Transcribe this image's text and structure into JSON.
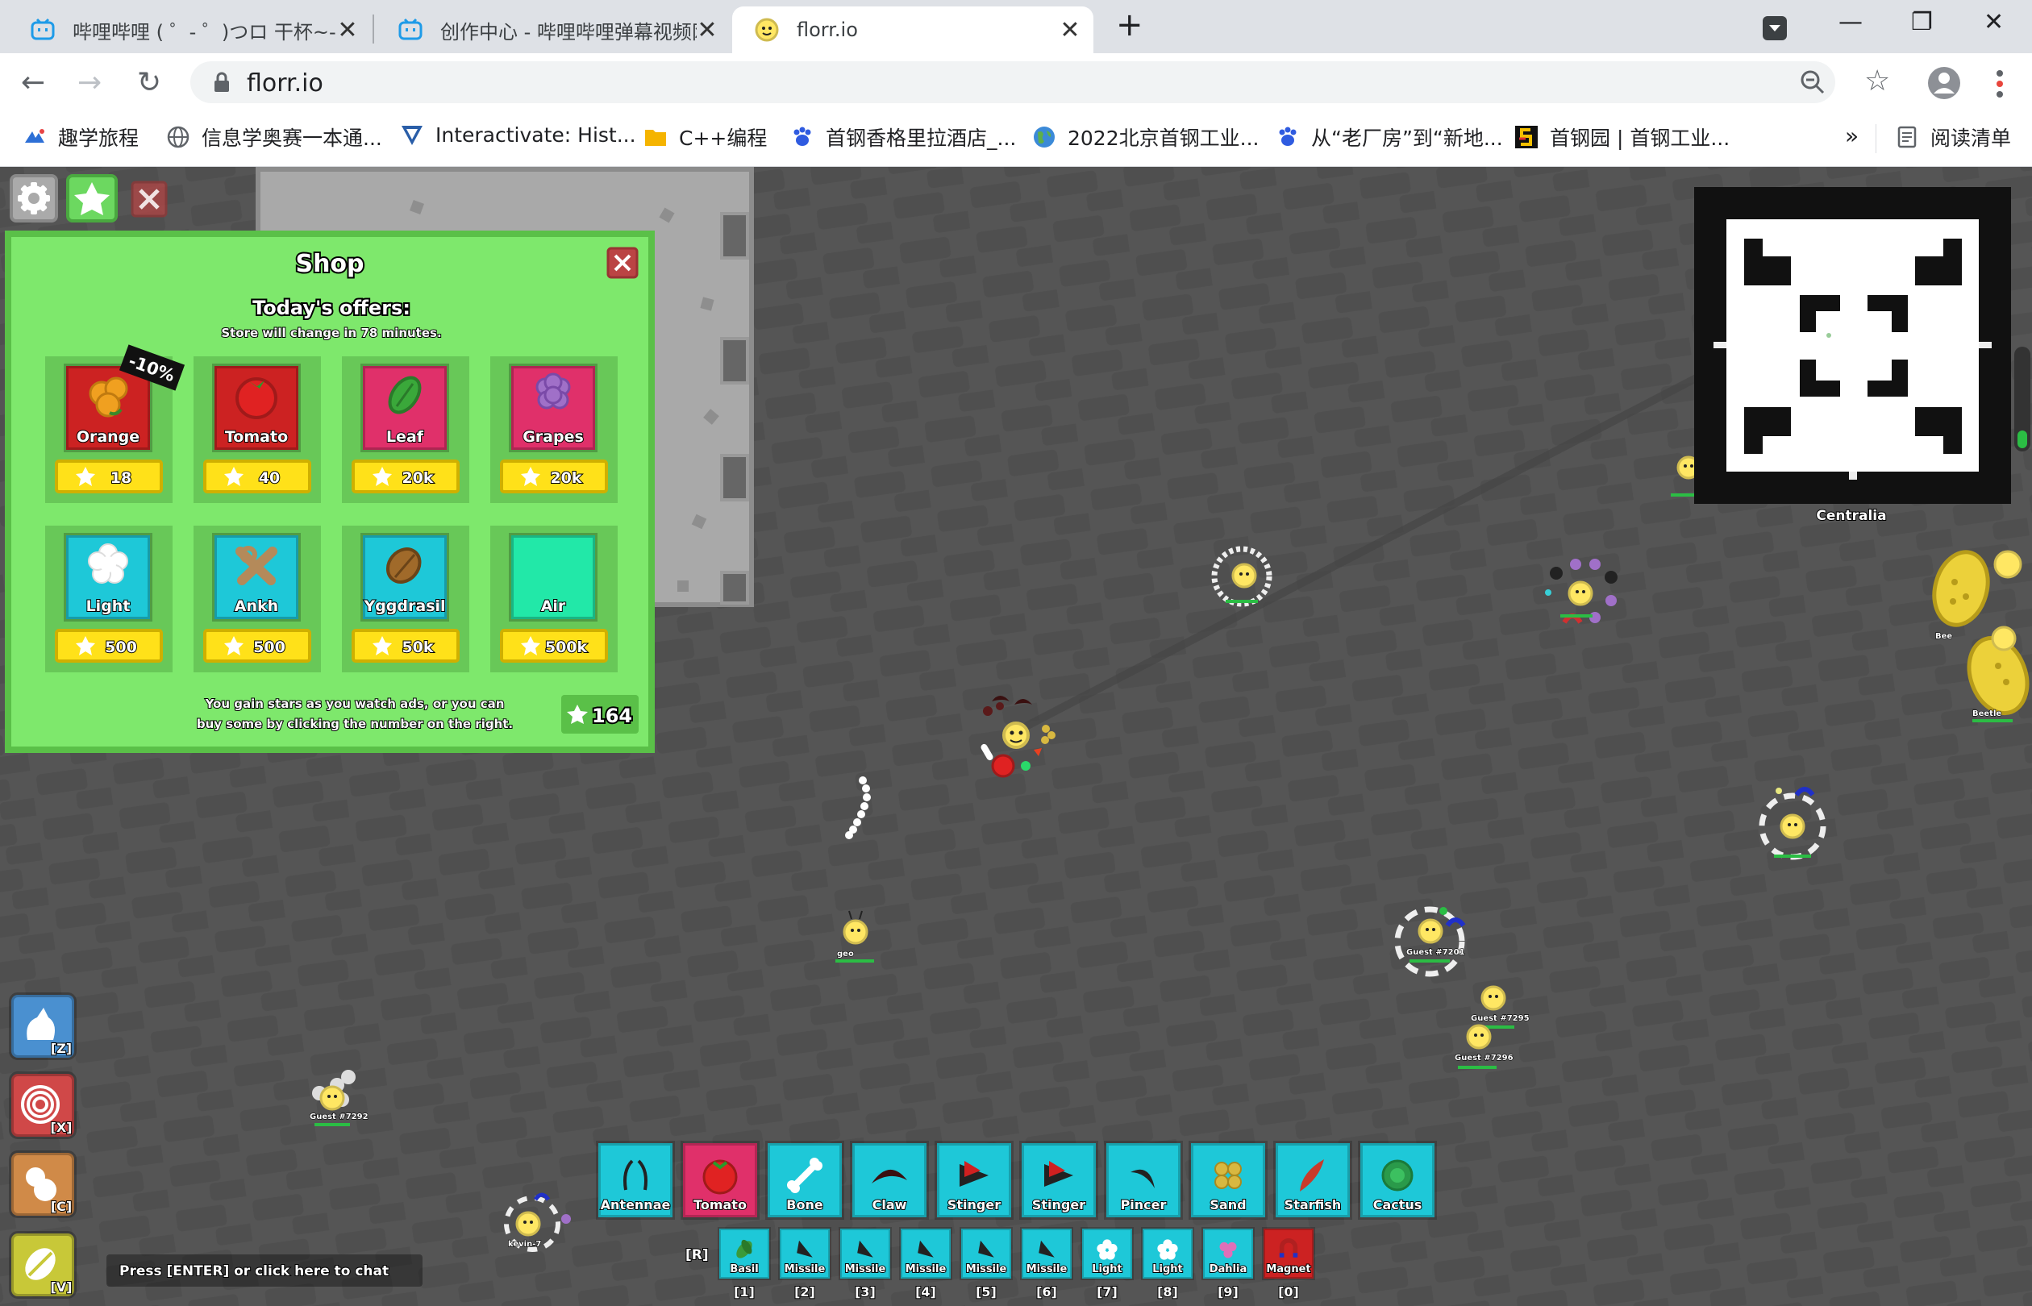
{
  "browser": {
    "tabs": [
      {
        "title": "哔哩哔哩 ( ゜- ゜)つロ 干杯~-b",
        "active": false,
        "icon": "bilibili-icon"
      },
      {
        "title": "创作中心 - 哔哩哔哩弹幕视频网",
        "active": false,
        "icon": "bilibili-icon"
      },
      {
        "title": "florr.io",
        "active": true,
        "icon": "florr-icon"
      }
    ],
    "new_tab": "+",
    "url": "florr.io",
    "bookmarks": [
      "趣学旅程",
      "信息学奥赛一本通...",
      "Interactivate: Hist...",
      "C++编程",
      "首钢香格里拉酒店_...",
      "2022北京首钢工业...",
      "从“老厂房”到“新地...",
      "首钢园 | 首钢工业..."
    ],
    "more_bookmarks": "»",
    "reading_list": "阅读清单",
    "colors": {
      "tabstrip": "#dee1e6",
      "toolbar": "#ffffff"
    }
  },
  "shop": {
    "title": "Shop",
    "subtitle": "Today's offers:",
    "refresh_note": "Store will change in 78 minutes.",
    "items": [
      {
        "name": "Orange",
        "price": "18",
        "rarity_color": "#cc2222",
        "discount": "-10%"
      },
      {
        "name": "Tomato",
        "price": "40",
        "rarity_color": "#cc2222",
        "discount": ""
      },
      {
        "name": "Leaf",
        "price": "20k",
        "rarity_color": "#e0306a",
        "discount": ""
      },
      {
        "name": "Grapes",
        "price": "20k",
        "rarity_color": "#e0306a",
        "discount": ""
      },
      {
        "name": "Light",
        "price": "500",
        "rarity_color": "#1ec8d8",
        "discount": ""
      },
      {
        "name": "Ankh",
        "price": "500",
        "rarity_color": "#1ec8d8",
        "discount": ""
      },
      {
        "name": "Yggdrasil",
        "price": "50k",
        "rarity_color": "#1ec8d8",
        "discount": ""
      },
      {
        "name": "Air",
        "price": "500k",
        "rarity_color": "#22e8a8",
        "discount": ""
      }
    ],
    "footer": [
      "You gain stars as you watch ads, or you can",
      "buy some by clicking the number on the right."
    ],
    "star_count": "164",
    "colors": {
      "panel": "#7ee86c",
      "border": "#5ac048",
      "price_bar": "#ffe119"
    }
  },
  "minimap": {
    "label": "Centralia"
  },
  "abilities": [
    {
      "key": "[Z]",
      "icon": "bag-icon",
      "color": "#4a90d0"
    },
    {
      "key": "[X]",
      "icon": "swirl-icon",
      "color": "#d04848"
    },
    {
      "key": "[C]",
      "icon": "flower-icon",
      "color": "#d08a48"
    },
    {
      "key": "[V]",
      "icon": "bee-icon",
      "color": "#c8c838"
    }
  ],
  "chat_prompt": "Press [ENTER] or click here to chat",
  "loadout": {
    "primary": [
      {
        "name": "Antennae",
        "color": "#1ec8d8"
      },
      {
        "name": "Tomato",
        "color": "#e0306a"
      },
      {
        "name": "Bone",
        "color": "#1ec8d8"
      },
      {
        "name": "Claw",
        "color": "#1ec8d8"
      },
      {
        "name": "Stinger",
        "color": "#1ec8d8"
      },
      {
        "name": "Stinger",
        "color": "#1ec8d8"
      },
      {
        "name": "Pincer",
        "color": "#1ec8d8"
      },
      {
        "name": "Sand",
        "color": "#1ec8d8"
      },
      {
        "name": "Starfish",
        "color": "#1ec8d8"
      },
      {
        "name": "Cactus",
        "color": "#1ec8d8"
      }
    ],
    "swap_key": "[R]",
    "secondary": [
      {
        "name": "Basil",
        "key": "[1]",
        "color": "#1ec8d8"
      },
      {
        "name": "Missile",
        "key": "[2]",
        "color": "#1ec8d8"
      },
      {
        "name": "Missile",
        "key": "[3]",
        "color": "#1ec8d8"
      },
      {
        "name": "Missile",
        "key": "[4]",
        "color": "#1ec8d8"
      },
      {
        "name": "Missile",
        "key": "[5]",
        "color": "#1ec8d8"
      },
      {
        "name": "Missile",
        "key": "[6]",
        "color": "#1ec8d8"
      },
      {
        "name": "Light",
        "key": "[7]",
        "color": "#1ec8d8"
      },
      {
        "name": "Light",
        "key": "[8]",
        "color": "#1ec8d8"
      },
      {
        "name": "Dahlia",
        "key": "[9]",
        "color": "#1ec8d8"
      },
      {
        "name": "Magnet",
        "key": "[0]",
        "color": "#cc2222"
      }
    ]
  },
  "players": [
    {
      "name": "geo"
    },
    {
      "name": "Guest #7201"
    },
    {
      "name": "Guest #7295"
    },
    {
      "name": "Guest #7296"
    },
    {
      "name": "kevin-7"
    },
    {
      "name": "Guest #7292"
    },
    {
      "name": "Beetle"
    },
    {
      "name": "Bee"
    }
  ]
}
